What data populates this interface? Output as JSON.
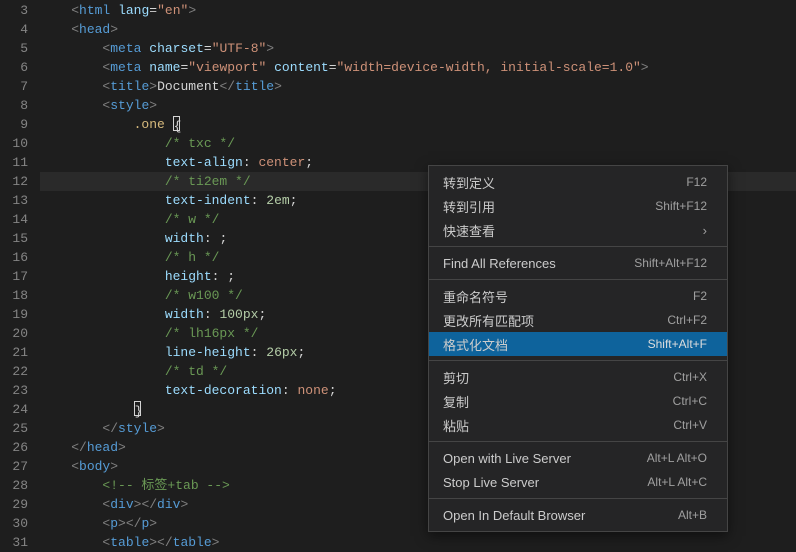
{
  "gutter_start": 3,
  "gutter_end": 31,
  "lines": [
    [
      [
        "    ",
        ""
      ],
      [
        "<",
        "t-punc"
      ],
      [
        "html",
        "t-tag"
      ],
      [
        " ",
        ""
      ],
      [
        "lang",
        "t-attr"
      ],
      [
        "=",
        ""
      ],
      [
        "\"en\"",
        "t-str"
      ],
      [
        ">",
        "t-punc"
      ]
    ],
    [
      [
        "    ",
        ""
      ],
      [
        "<",
        "t-punc"
      ],
      [
        "head",
        "t-tag"
      ],
      [
        ">",
        "t-punc"
      ]
    ],
    [
      [
        "        ",
        ""
      ],
      [
        "<",
        "t-punc"
      ],
      [
        "meta",
        "t-tag"
      ],
      [
        " ",
        ""
      ],
      [
        "charset",
        "t-attr"
      ],
      [
        "=",
        ""
      ],
      [
        "\"UTF-8\"",
        "t-str"
      ],
      [
        ">",
        "t-punc"
      ]
    ],
    [
      [
        "        ",
        ""
      ],
      [
        "<",
        "t-punc"
      ],
      [
        "meta",
        "t-tag"
      ],
      [
        " ",
        ""
      ],
      [
        "name",
        "t-attr"
      ],
      [
        "=",
        ""
      ],
      [
        "\"viewport\"",
        "t-str"
      ],
      [
        " ",
        ""
      ],
      [
        "content",
        "t-attr"
      ],
      [
        "=",
        ""
      ],
      [
        "\"width=device-width, initial-scale=1.0\"",
        "t-str"
      ],
      [
        ">",
        "t-punc"
      ]
    ],
    [
      [
        "        ",
        ""
      ],
      [
        "<",
        "t-punc"
      ],
      [
        "title",
        "t-tag"
      ],
      [
        ">",
        "t-punc"
      ],
      [
        "Document",
        "t-txt"
      ],
      [
        "</",
        "t-punc"
      ],
      [
        "title",
        "t-tag"
      ],
      [
        ">",
        "t-punc"
      ]
    ],
    [
      [
        "        ",
        ""
      ],
      [
        "<",
        "t-punc"
      ],
      [
        "style",
        "t-tag"
      ],
      [
        ">",
        "t-punc"
      ]
    ],
    [
      [
        "            ",
        ""
      ],
      [
        ".one",
        "t-sel"
      ],
      [
        " ",
        ""
      ],
      [
        "{",
        "cursor-box"
      ]
    ],
    [
      [
        "                ",
        ""
      ],
      [
        "/* txc */",
        "t-cmt"
      ]
    ],
    [
      [
        "                ",
        ""
      ],
      [
        "text-align",
        "t-prop"
      ],
      [
        ": ",
        ""
      ],
      [
        "center",
        "t-val"
      ],
      [
        ";",
        ""
      ]
    ],
    [
      [
        "                ",
        ""
      ],
      [
        "/* ti2em */",
        "t-cmt"
      ]
    ],
    [
      [
        "                ",
        ""
      ],
      [
        "text-indent",
        "t-prop"
      ],
      [
        ": ",
        ""
      ],
      [
        "2em",
        "t-num"
      ],
      [
        ";",
        ""
      ]
    ],
    [
      [
        "                ",
        ""
      ],
      [
        "/* w */",
        "t-cmt"
      ]
    ],
    [
      [
        "                ",
        ""
      ],
      [
        "width",
        "t-prop"
      ],
      [
        ": ;",
        ""
      ]
    ],
    [
      [
        "                ",
        ""
      ],
      [
        "/* h */",
        "t-cmt"
      ]
    ],
    [
      [
        "                ",
        ""
      ],
      [
        "height",
        "t-prop"
      ],
      [
        ": ;",
        ""
      ]
    ],
    [
      [
        "                ",
        ""
      ],
      [
        "/* w100 */",
        "t-cmt"
      ]
    ],
    [
      [
        "                ",
        ""
      ],
      [
        "width",
        "t-prop"
      ],
      [
        ": ",
        ""
      ],
      [
        "100px",
        "t-num"
      ],
      [
        ";",
        ""
      ]
    ],
    [
      [
        "                ",
        ""
      ],
      [
        "/* lh16px */",
        "t-cmt"
      ]
    ],
    [
      [
        "                ",
        ""
      ],
      [
        "line-height",
        "t-prop"
      ],
      [
        ": ",
        ""
      ],
      [
        "26px",
        "t-num"
      ],
      [
        ";",
        ""
      ]
    ],
    [
      [
        "                ",
        ""
      ],
      [
        "/* td */",
        "t-cmt"
      ]
    ],
    [
      [
        "                ",
        ""
      ],
      [
        "text-decoration",
        "t-prop"
      ],
      [
        ": ",
        ""
      ],
      [
        "none",
        "t-val"
      ],
      [
        ";",
        ""
      ]
    ],
    [
      [
        "            ",
        ""
      ],
      [
        "}",
        "cursor-box"
      ]
    ],
    [
      [
        "        ",
        ""
      ],
      [
        "</",
        "t-punc"
      ],
      [
        "style",
        "t-tag"
      ],
      [
        ">",
        "t-punc"
      ]
    ],
    [
      [
        "    ",
        ""
      ],
      [
        "</",
        "t-punc"
      ],
      [
        "head",
        "t-tag"
      ],
      [
        ">",
        "t-punc"
      ]
    ],
    [
      [
        "    ",
        ""
      ],
      [
        "<",
        "t-punc"
      ],
      [
        "body",
        "t-tag"
      ],
      [
        ">",
        "t-punc"
      ]
    ],
    [
      [
        "        ",
        ""
      ],
      [
        "<!-- 标签+tab -->",
        "t-cmt"
      ]
    ],
    [
      [
        "        ",
        ""
      ],
      [
        "<",
        "t-punc"
      ],
      [
        "div",
        "t-tag"
      ],
      [
        "></",
        "t-punc"
      ],
      [
        "div",
        "t-tag"
      ],
      [
        ">",
        "t-punc"
      ]
    ],
    [
      [
        "        ",
        ""
      ],
      [
        "<",
        "t-punc"
      ],
      [
        "p",
        "t-tag"
      ],
      [
        "></",
        "t-punc"
      ],
      [
        "p",
        "t-tag"
      ],
      [
        ">",
        "t-punc"
      ]
    ],
    [
      [
        "        ",
        ""
      ],
      [
        "<",
        "t-punc"
      ],
      [
        "table",
        "t-tag"
      ],
      [
        "></",
        "t-punc"
      ],
      [
        "table",
        "t-tag"
      ],
      [
        ">",
        "t-punc"
      ]
    ]
  ],
  "highlighted_line_index": 9,
  "menu": [
    {
      "type": "item",
      "label": "转到定义",
      "shortcut": "F12"
    },
    {
      "type": "item",
      "label": "转到引用",
      "shortcut": "Shift+F12"
    },
    {
      "type": "item",
      "label": "快速查看",
      "shortcut": "",
      "chevron": true
    },
    {
      "type": "sep"
    },
    {
      "type": "item",
      "label": "Find All References",
      "shortcut": "Shift+Alt+F12"
    },
    {
      "type": "sep"
    },
    {
      "type": "item",
      "label": "重命名符号",
      "shortcut": "F2"
    },
    {
      "type": "item",
      "label": "更改所有匹配项",
      "shortcut": "Ctrl+F2"
    },
    {
      "type": "item",
      "label": "格式化文档",
      "shortcut": "Shift+Alt+F",
      "selected": true
    },
    {
      "type": "sep"
    },
    {
      "type": "item",
      "label": "剪切",
      "shortcut": "Ctrl+X"
    },
    {
      "type": "item",
      "label": "复制",
      "shortcut": "Ctrl+C"
    },
    {
      "type": "item",
      "label": "粘贴",
      "shortcut": "Ctrl+V"
    },
    {
      "type": "sep"
    },
    {
      "type": "item",
      "label": "Open with Live Server",
      "shortcut": "Alt+L Alt+O"
    },
    {
      "type": "item",
      "label": "Stop Live Server",
      "shortcut": "Alt+L Alt+C"
    },
    {
      "type": "sep"
    },
    {
      "type": "item",
      "label": "Open In Default Browser",
      "shortcut": "Alt+B"
    }
  ]
}
